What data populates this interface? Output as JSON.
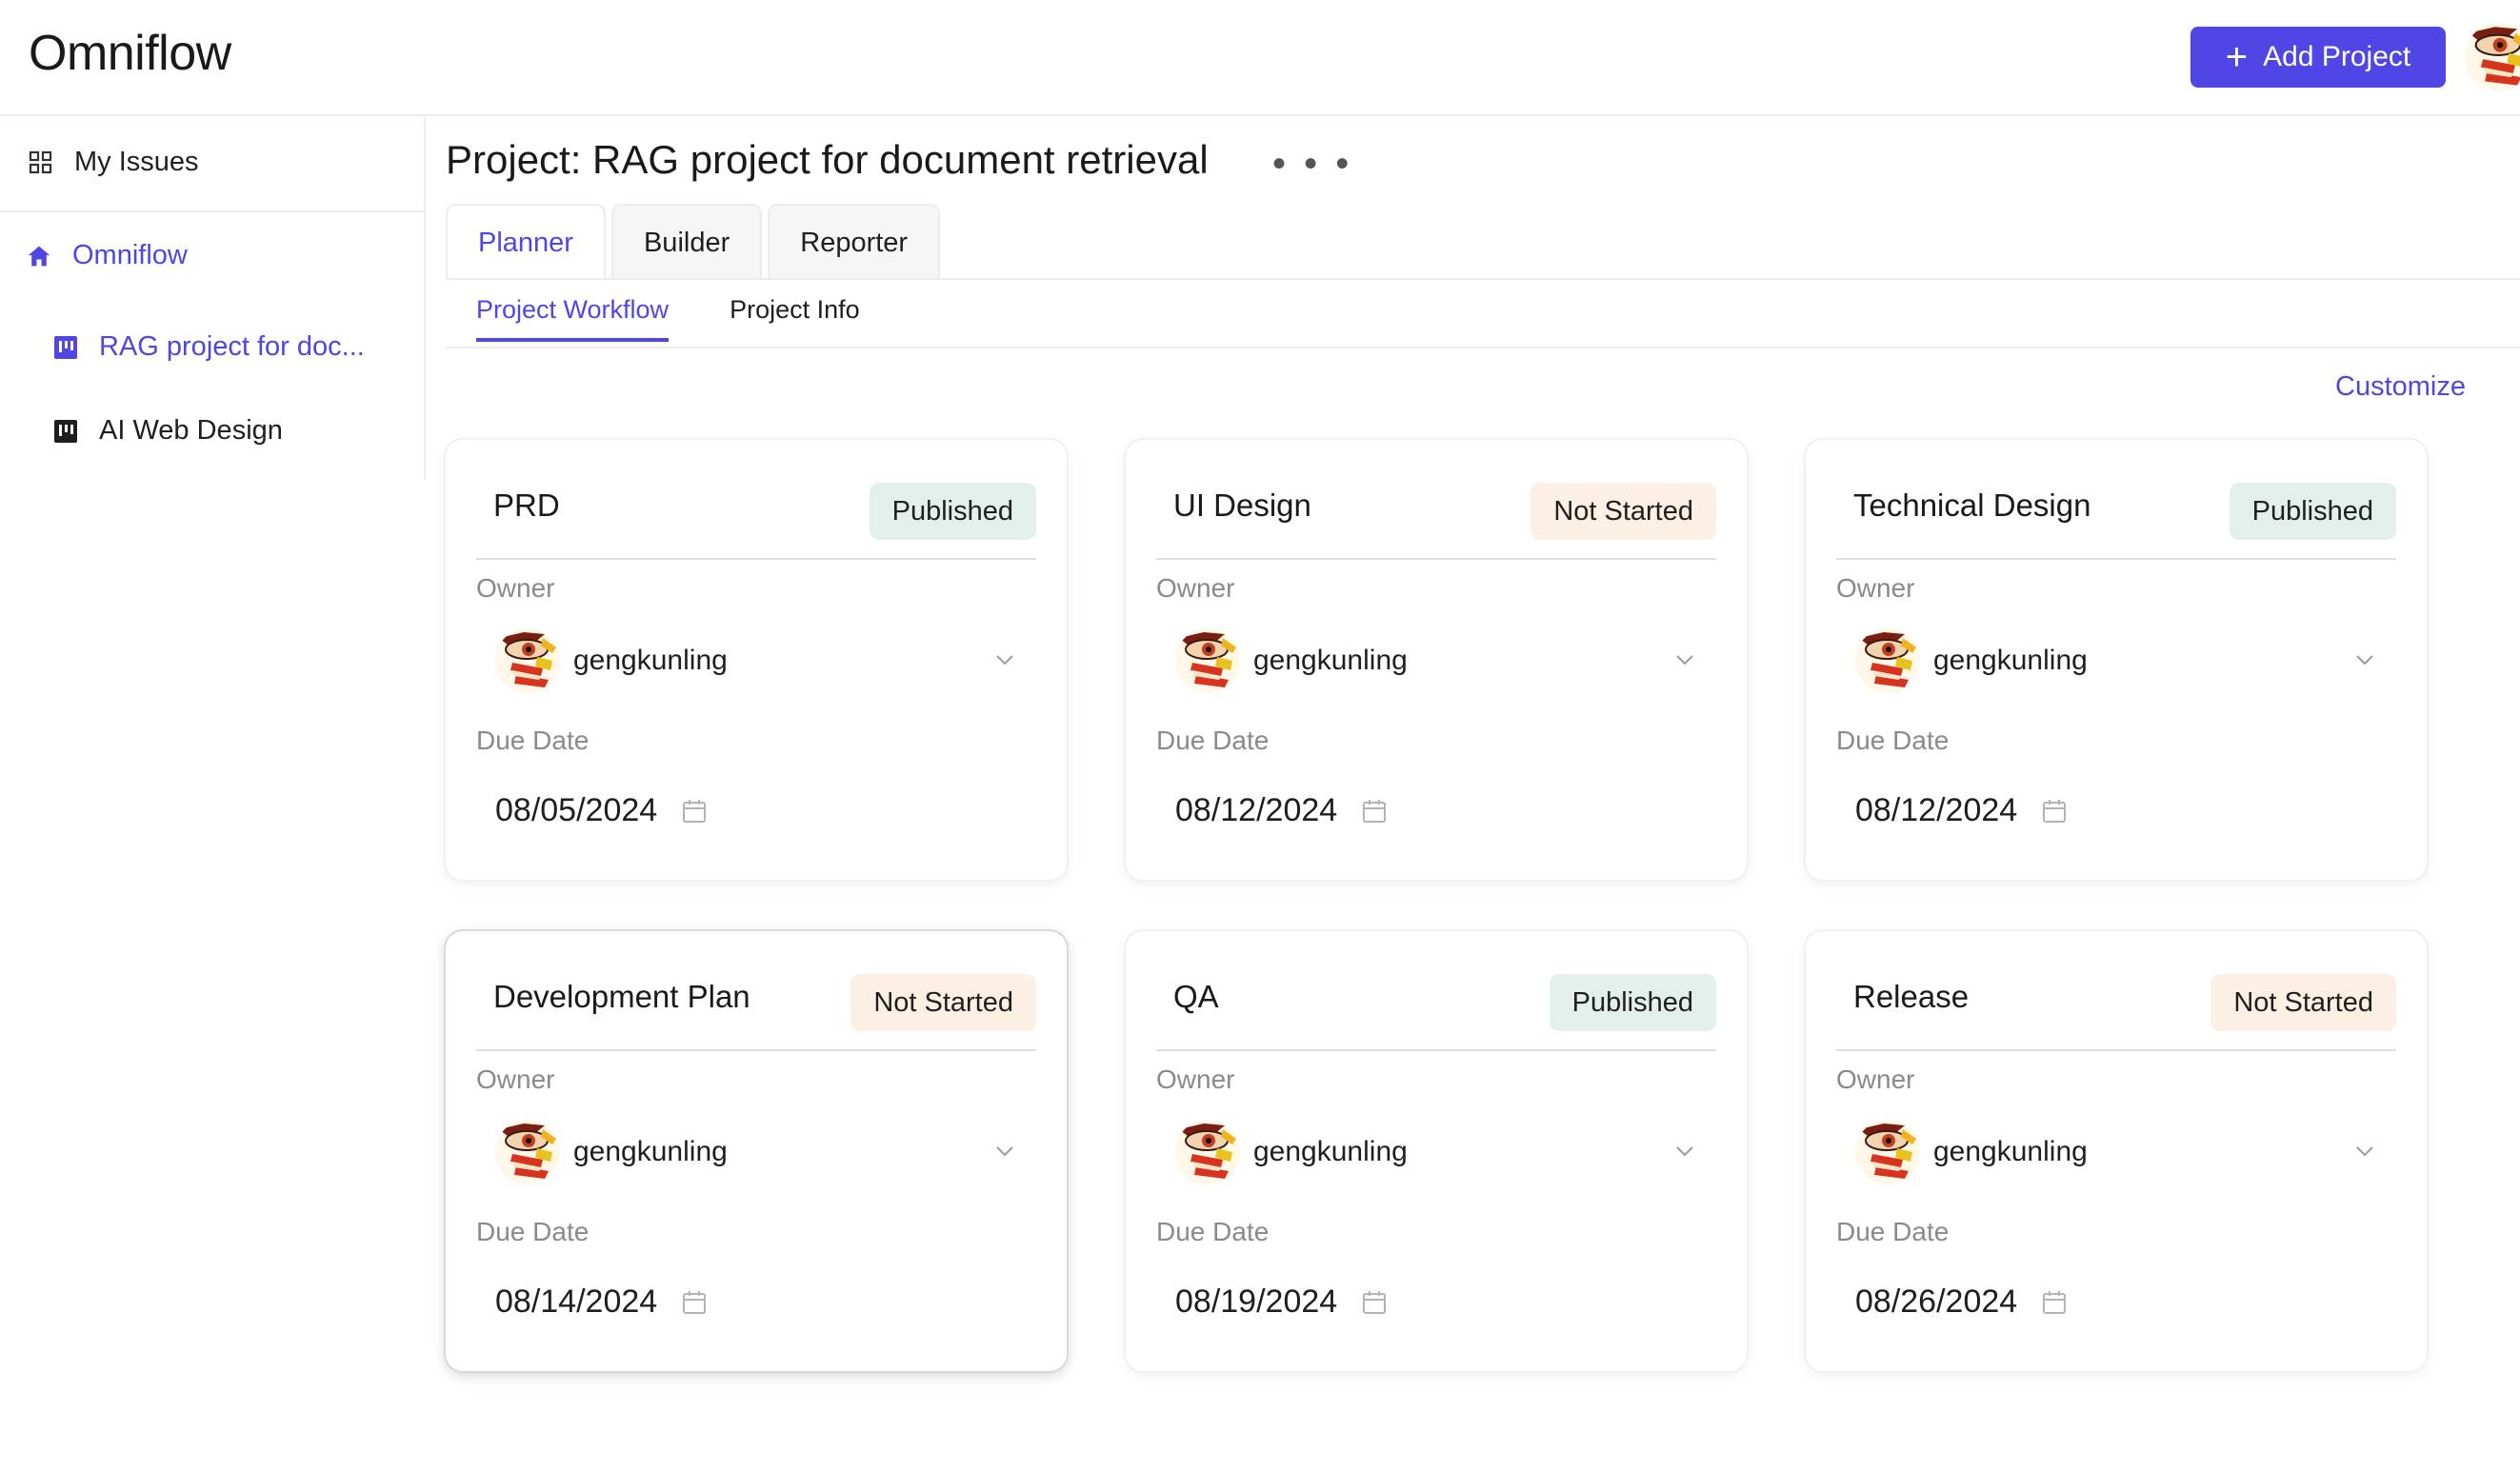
{
  "app": {
    "title": "Omniflow"
  },
  "header": {
    "add_project_label": "Add Project",
    "add_icon": "plus-icon"
  },
  "sidebar": {
    "items": [
      {
        "label": "My Issues",
        "icon": "grid-icon"
      },
      {
        "label": "Omniflow",
        "icon": "home-icon"
      },
      {
        "label": "RAG project for doc...",
        "icon": "board-icon"
      },
      {
        "label": "AI Web Design",
        "icon": "board-icon"
      }
    ]
  },
  "project": {
    "title": "Project: RAG project for document retrieval",
    "more": "• • •"
  },
  "tabs": [
    {
      "label": "Planner"
    },
    {
      "label": "Builder"
    },
    {
      "label": "Reporter"
    }
  ],
  "subtabs": [
    {
      "label": "Project Workflow"
    },
    {
      "label": "Project Info"
    }
  ],
  "customize_label": "Customize",
  "card_labels": {
    "owner": "Owner",
    "due": "Due Date"
  },
  "cards": [
    {
      "title": "PRD",
      "status": "Published",
      "owner": "gengkunling",
      "due": "08/05/2024"
    },
    {
      "title": "UI Design",
      "status": "Not Started",
      "owner": "gengkunling",
      "due": "08/12/2024"
    },
    {
      "title": "Technical Design",
      "status": "Published",
      "owner": "gengkunling",
      "due": "08/12/2024"
    },
    {
      "title": "Development Plan",
      "status": "Not Started",
      "owner": "gengkunling",
      "due": "08/14/2024"
    },
    {
      "title": "QA",
      "status": "Published",
      "owner": "gengkunling",
      "due": "08/19/2024"
    },
    {
      "title": "Release",
      "status": "Not Started",
      "owner": "gengkunling",
      "due": "08/26/2024"
    }
  ],
  "colors": {
    "accent": "#4f46e5",
    "published_bg": "#e3efea",
    "not_started_bg": "#fcefe3"
  }
}
